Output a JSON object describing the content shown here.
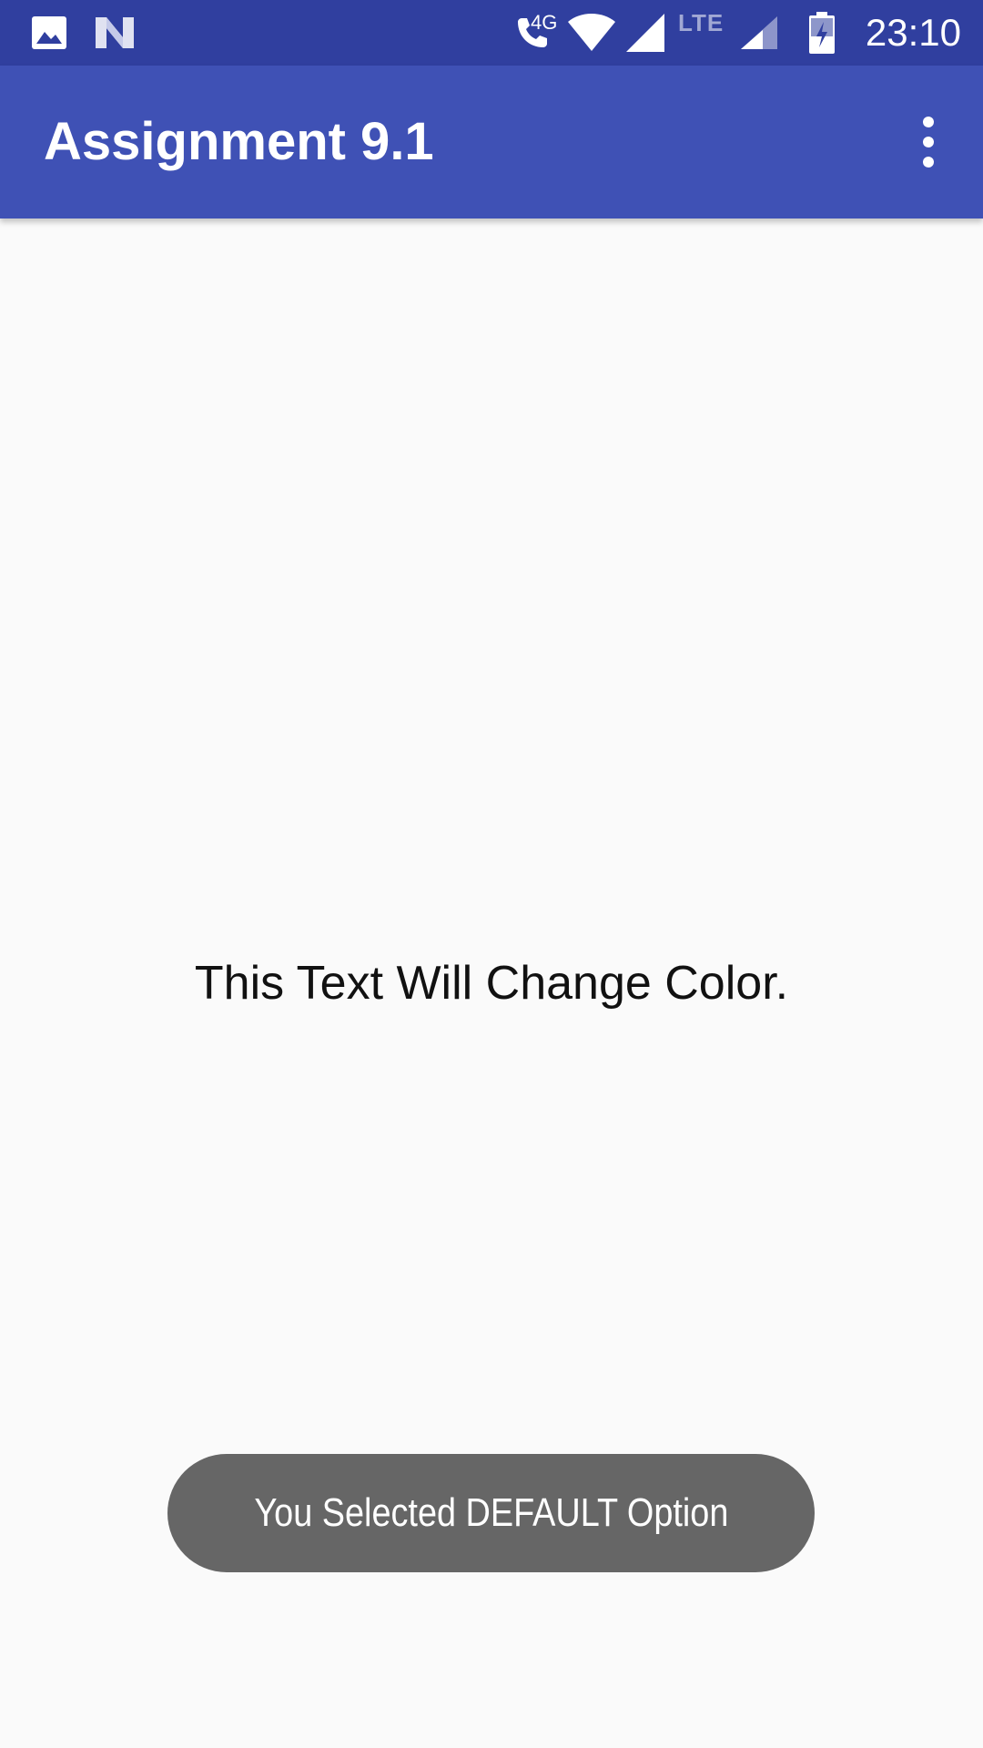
{
  "status_bar": {
    "time": "23:10",
    "network_4g_label": "4G",
    "network_lte_label": "LTE",
    "icons": [
      "image-icon",
      "n-logo-icon",
      "wifi-call-icon",
      "wifi-icon",
      "cell-signal-icon",
      "cell-signal-secondary-icon",
      "battery-charging-icon"
    ],
    "background_color": "#303f9f"
  },
  "app_bar": {
    "title": "Assignment 9.1",
    "overflow_icon": "more-vert-icon",
    "background_color": "#3f51b5"
  },
  "main": {
    "text": "This Text Will Change Color."
  },
  "toast": {
    "message": "You Selected DEFAULT Option",
    "background_color": "#666666"
  }
}
